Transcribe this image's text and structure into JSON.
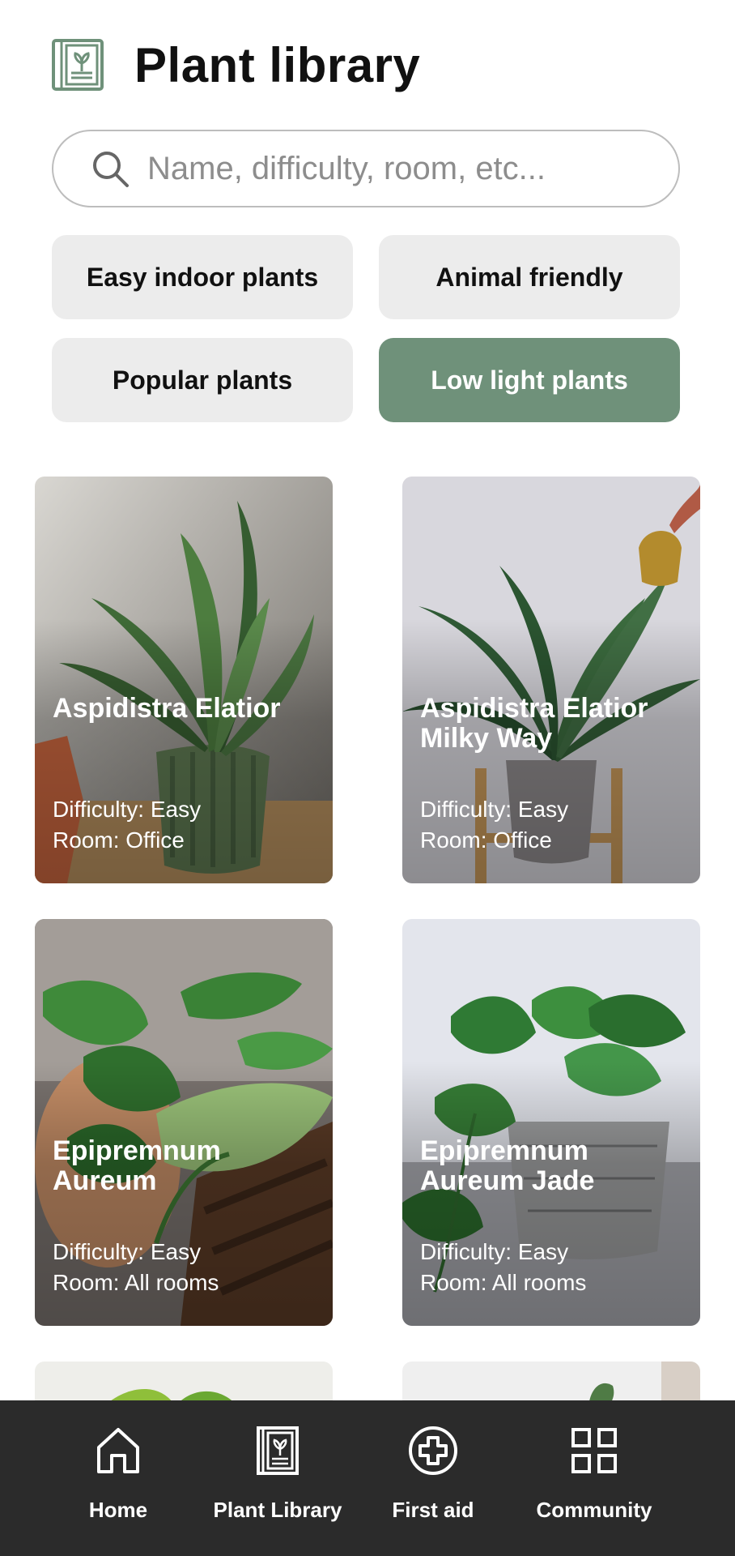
{
  "header": {
    "title": "Plant library",
    "logo_icon": "plant-book-icon"
  },
  "search": {
    "placeholder": "Name, difficulty, room, etc..."
  },
  "filters": [
    {
      "label": "Easy indoor plants",
      "active": false
    },
    {
      "label": "Animal friendly",
      "active": false
    },
    {
      "label": "Popular plants",
      "active": false
    },
    {
      "label": "Low light plants",
      "active": true
    }
  ],
  "plants": [
    {
      "name": "Aspidistra Elatior",
      "difficulty": "Difficulty: Easy",
      "room": "Room: Office"
    },
    {
      "name": "Aspidistra Elatior Milky Way",
      "difficulty": "Difficulty: Easy",
      "room": "Room: Office"
    },
    {
      "name": "Epipremnum Aureum",
      "difficulty": "Difficulty: Easy",
      "room": "Room: All rooms"
    },
    {
      "name": "Epipremnum Aureum Jade",
      "difficulty": "Difficulty: Easy",
      "room": "Room: All rooms"
    }
  ],
  "nav": [
    {
      "label": "Home",
      "icon": "home-icon"
    },
    {
      "label": "Plant Library",
      "icon": "plant-book-icon"
    },
    {
      "label": "First aid",
      "icon": "first-aid-icon"
    },
    {
      "label": "Community",
      "icon": "grid-icon"
    }
  ],
  "colors": {
    "accent": "#6f917a",
    "nav_bg": "#2b2b2b",
    "chip_bg": "#ececec"
  }
}
